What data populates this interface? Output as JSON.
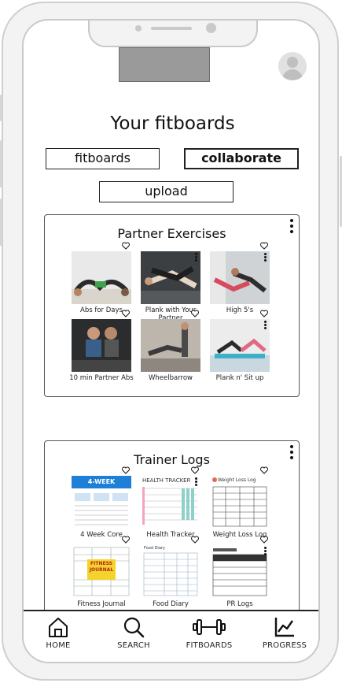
{
  "header": {
    "title": "Your fitboards"
  },
  "tabs": {
    "fitboards": "fitboards",
    "collaborate": "collaborate",
    "upload": "upload"
  },
  "boards": [
    {
      "title": "Partner Exercises",
      "items": [
        {
          "label": "Abs for Days"
        },
        {
          "label": "Plank with Your Partner"
        },
        {
          "label": "High 5's"
        },
        {
          "label": "10 min Partner Abs"
        },
        {
          "label": "Wheelbarrow"
        },
        {
          "label": "Plank n' Sit up"
        }
      ]
    },
    {
      "title": "Trainer Logs",
      "items": [
        {
          "label": "4 Week Core",
          "thumb_text": "4-WEEK"
        },
        {
          "label": "Health Tracker",
          "thumb_text": "HEALTH TRACKER"
        },
        {
          "label": "Weight Loss Log",
          "thumb_text": "Weight Loss Log"
        },
        {
          "label": "Fitness Journal",
          "thumb_text": "FITNESS JOURNAL"
        },
        {
          "label": "Food Diary",
          "thumb_text": "Food Diary"
        },
        {
          "label": "PR Logs"
        }
      ]
    }
  ],
  "nav": [
    {
      "label": "HOME",
      "icon": "home-icon"
    },
    {
      "label": "SEARCH",
      "icon": "search-icon"
    },
    {
      "label": "FITBOARDS",
      "icon": "dumbbell-icon"
    },
    {
      "label": "PROGRESS",
      "icon": "chart-icon"
    }
  ],
  "colors": {
    "frame": "#cfcfcf",
    "logo_placeholder": "#9a9a9a",
    "core_blue": "#1d7fd6",
    "journal_yellow": "#f4d42c"
  }
}
